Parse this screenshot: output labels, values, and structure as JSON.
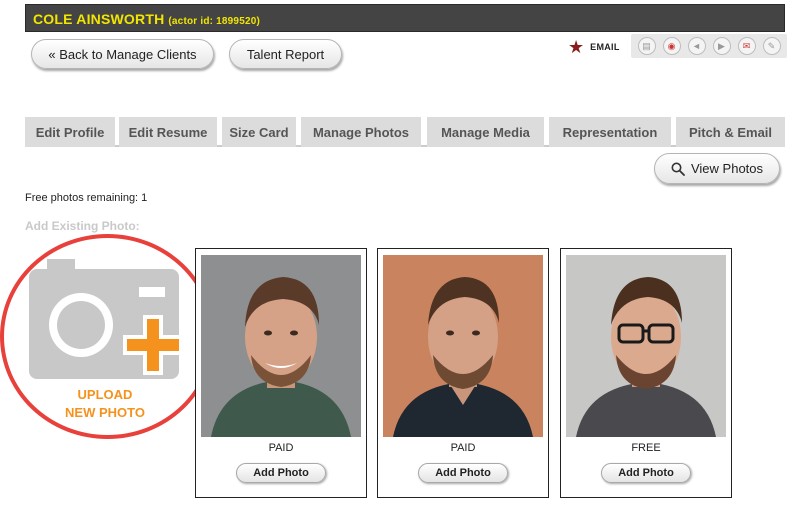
{
  "header": {
    "actor_name": "COLE AINSWORTH",
    "actor_id_text": "(actor id: 1899520)"
  },
  "top_buttons": {
    "back_label": "« Back to Manage Clients",
    "talent_report_label": "Talent Report"
  },
  "email": {
    "label": "EMAIL",
    "icon": "star-icon",
    "star_color": "#8b1c1c"
  },
  "toolbar_icons": [
    "document-icon",
    "camera-icon",
    "audio-icon",
    "video-icon",
    "mail-icon",
    "edit-icon"
  ],
  "tabs": [
    {
      "label": "Edit Profile"
    },
    {
      "label": "Edit Resume"
    },
    {
      "label": "Size Card"
    },
    {
      "label": "Manage Photos"
    },
    {
      "label": "Manage Media"
    },
    {
      "label": "Representation"
    },
    {
      "label": "Pitch & Email"
    }
  ],
  "view_photos": {
    "label": "View Photos",
    "icon": "search-icon"
  },
  "free_photos_text": "Free photos remaining: 1",
  "add_existing_label": "Add Existing Photo:",
  "upload": {
    "line1": "UPLOAD",
    "line2": "NEW PHOTO",
    "accent_color": "#f5921e",
    "highlight_color": "#e8413b"
  },
  "photos": [
    {
      "status": "PAID",
      "button_label": "Add Photo",
      "background": "gray"
    },
    {
      "status": "PAID",
      "button_label": "Add Photo",
      "background": "orange"
    },
    {
      "status": "FREE",
      "button_label": "Add Photo",
      "background": "light-gray"
    }
  ],
  "colors": {
    "title_bar": "#444444",
    "title_text": "#f2e600",
    "tab_bg": "#dcdcdc"
  }
}
